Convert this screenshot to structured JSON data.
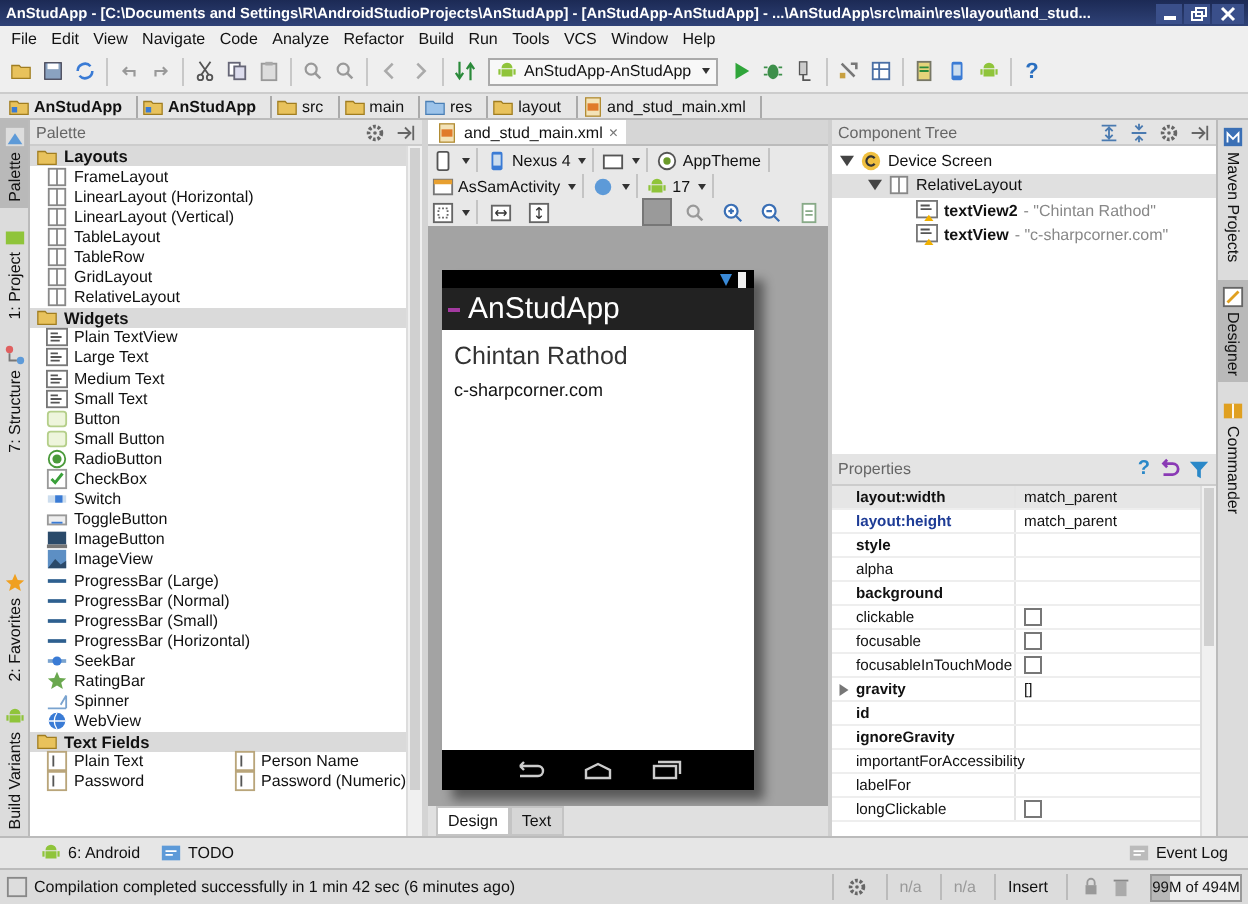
{
  "window": {
    "title": "AnStudApp - [C:\\Documents and Settings\\R\\AndroidStudioProjects\\AnStudApp] - [AnStudApp-AnStudApp] - ...\\AnStudApp\\src\\main\\res\\layout\\and_stud..."
  },
  "menu": [
    "File",
    "Edit",
    "View",
    "Navigate",
    "Code",
    "Analyze",
    "Refactor",
    "Build",
    "Run",
    "Tools",
    "VCS",
    "Window",
    "Help"
  ],
  "toolbar": {
    "run_config": "AnStudApp-AnStudApp",
    "help": "?"
  },
  "breadcrumbs": [
    {
      "label": "AnStudApp",
      "kind": "module"
    },
    {
      "label": "AnStudApp",
      "kind": "module"
    },
    {
      "label": "src",
      "kind": "folder"
    },
    {
      "label": "main",
      "kind": "folder"
    },
    {
      "label": "res",
      "kind": "resources"
    },
    {
      "label": "layout",
      "kind": "folder"
    },
    {
      "label": "and_stud_main.xml",
      "kind": "file"
    }
  ],
  "left_tabs": [
    {
      "label": "Palette",
      "selected": true
    },
    {
      "label": "1: Project",
      "selected": false
    },
    {
      "label": "7: Structure",
      "selected": false
    }
  ],
  "left_tabs_bottom": [
    {
      "label": "2: Favorites",
      "selected": false
    },
    {
      "label": "Build Variants",
      "selected": false
    }
  ],
  "palette": {
    "title": "Palette",
    "groups": [
      {
        "name": "Layouts",
        "items": [
          {
            "label": "FrameLayout",
            "kind": "layout"
          },
          {
            "label": "LinearLayout (Horizontal)",
            "kind": "layout"
          },
          {
            "label": "LinearLayout (Vertical)",
            "kind": "layout"
          },
          {
            "label": "TableLayout",
            "kind": "layout"
          },
          {
            "label": "TableRow",
            "kind": "layout"
          },
          {
            "label": "GridLayout",
            "kind": "layout"
          },
          {
            "label": "RelativeLayout",
            "kind": "layout"
          }
        ]
      },
      {
        "name": "Widgets",
        "items": [
          {
            "label": "Plain TextView",
            "kind": "text"
          },
          {
            "label": "Large Text",
            "kind": "text"
          },
          {
            "label": "Medium Text",
            "kind": "text"
          },
          {
            "label": "Small Text",
            "kind": "text"
          },
          {
            "label": "Button",
            "kind": "button"
          },
          {
            "label": "Small Button",
            "kind": "button"
          },
          {
            "label": "RadioButton",
            "kind": "radio"
          },
          {
            "label": "CheckBox",
            "kind": "check"
          },
          {
            "label": "Switch",
            "kind": "switch"
          },
          {
            "label": "ToggleButton",
            "kind": "toggle"
          },
          {
            "label": "ImageButton",
            "kind": "imagebutton"
          },
          {
            "label": "ImageView",
            "kind": "image"
          },
          {
            "label": "ProgressBar (Large)",
            "kind": "progress"
          },
          {
            "label": "ProgressBar (Normal)",
            "kind": "progress"
          },
          {
            "label": "ProgressBar (Small)",
            "kind": "progress"
          },
          {
            "label": "ProgressBar (Horizontal)",
            "kind": "progress"
          },
          {
            "label": "SeekBar",
            "kind": "seek"
          },
          {
            "label": "RatingBar",
            "kind": "rating"
          },
          {
            "label": "Spinner",
            "kind": "spinner"
          },
          {
            "label": "WebView",
            "kind": "web"
          }
        ]
      },
      {
        "name": "Text Fields",
        "items": [
          {
            "label": "Plain Text",
            "kind": "field"
          },
          {
            "label": "Person Name",
            "kind": "field"
          },
          {
            "label": "Password",
            "kind": "field"
          },
          {
            "label": "Password (Numeric)",
            "kind": "field"
          }
        ]
      }
    ]
  },
  "editor": {
    "tab": "and_stud_main.xml",
    "close": "×",
    "device": "Nexus 4",
    "theme": "AppTheme",
    "activity": "AsSamActivity",
    "api": "17",
    "phone": {
      "app_title": "AnStudApp",
      "texts": [
        "Chintan Rathod",
        "c-sharpcorner.com"
      ]
    },
    "bottom_tabs": [
      {
        "label": "Design",
        "selected": true
      },
      {
        "label": "Text",
        "selected": false
      }
    ]
  },
  "component_tree": {
    "title": "Component Tree",
    "nodes": [
      {
        "label": "Device Screen",
        "kind": "screen",
        "expanded": true,
        "selected": false,
        "children": [
          {
            "label": "RelativeLayout",
            "kind": "layout",
            "expanded": true,
            "selected": true,
            "children": [
              {
                "label": "textView2",
                "detail": "- \"Chintan Rathod\"",
                "kind": "text",
                "selected": false
              },
              {
                "label": "textView",
                "detail": "- \"c-sharpcorner.com\"",
                "kind": "text",
                "selected": false
              }
            ]
          }
        ]
      }
    ]
  },
  "properties": {
    "title": "Properties",
    "help": "?",
    "rows": [
      {
        "name": "layout:width",
        "important": true,
        "modified": false,
        "kind": "text",
        "value": "match_parent"
      },
      {
        "name": "layout:height",
        "important": true,
        "modified": true,
        "kind": "text",
        "value": "match_parent"
      },
      {
        "name": "style",
        "important": true,
        "modified": false,
        "kind": "text"
      },
      {
        "name": "alpha",
        "important": false,
        "modified": false,
        "kind": "text"
      },
      {
        "name": "background",
        "important": true,
        "modified": false,
        "kind": "text"
      },
      {
        "name": "clickable",
        "important": false,
        "modified": false,
        "kind": "checkbox",
        "checked": false
      },
      {
        "name": "focusable",
        "important": false,
        "modified": false,
        "kind": "checkbox",
        "checked": false
      },
      {
        "name": "focusableInTouchMode",
        "important": false,
        "modified": false,
        "kind": "checkbox",
        "checked": false
      },
      {
        "name": "gravity",
        "important": true,
        "modified": false,
        "kind": "text",
        "value": "[]",
        "expanded": false
      },
      {
        "name": "id",
        "important": true,
        "modified": false,
        "kind": "text"
      },
      {
        "name": "ignoreGravity",
        "important": true,
        "modified": false,
        "kind": "text"
      },
      {
        "name": "importantForAccessibility",
        "important": false,
        "modified": false,
        "kind": "text"
      },
      {
        "name": "labelFor",
        "important": false,
        "modified": false,
        "kind": "text"
      },
      {
        "name": "longClickable",
        "important": false,
        "modified": false,
        "kind": "checkbox",
        "checked": false
      }
    ]
  },
  "right_tabs": [
    {
      "label": "Maven Projects",
      "selected": false
    },
    {
      "label": "Designer",
      "selected": true
    },
    {
      "label": "Commander",
      "selected": false
    }
  ],
  "bottom_tools": [
    {
      "label": "6: Android",
      "kind": "android"
    },
    {
      "label": "TODO",
      "kind": "todo"
    }
  ],
  "event_log": "Event Log",
  "status": {
    "message": "Compilation completed successfully in 1 min 42 sec (6 minutes ago)",
    "position": "n/a",
    "column": "n/a",
    "mode": "Insert",
    "memory": "99M of 494M",
    "level": 0.2
  }
}
